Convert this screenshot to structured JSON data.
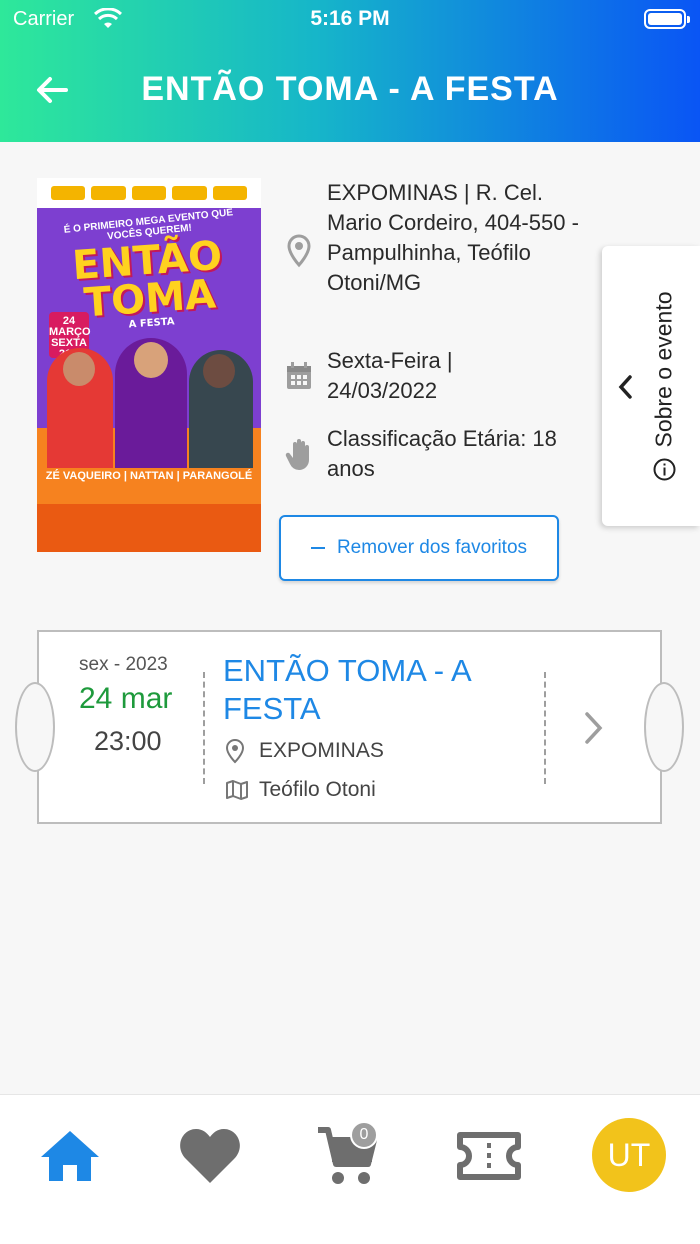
{
  "status_bar": {
    "carrier": "Carrier",
    "time": "5:16 PM"
  },
  "header": {
    "title": "ENTÃO TOMA - A FESTA",
    "back_icon": "arrow-left-icon"
  },
  "poster": {
    "tagline": "É O PRIMEIRO MEGA EVENTO QUE VOCÊS QUEREM!",
    "headline_1": "ENTÃO",
    "headline_2": "TOMA",
    "subheadline": "A FESTA",
    "date_badge": "24 MARÇO SEXTA 21H",
    "artists": "ZÉ VAQUEIRO | NATTAN | PARANGOLÉ"
  },
  "event": {
    "address": "EXPOMINAS | R. Cel. Mario Cordeiro, 404-550 - Pampulhinha, Teófilo Otoni/MG",
    "date": "Sexta-Feira | 24/03/2022",
    "rating": "Classificação Etária: 18 anos",
    "favorite_button": "Remover dos favoritos"
  },
  "side_tab": {
    "label": "Sobre o evento"
  },
  "ticket": {
    "weekday_year": "sex - 2023",
    "date": "24 mar",
    "time": "23:00",
    "title": "ENTÃO TOMA - A FESTA",
    "venue": "EXPOMINAS",
    "city": "Teófilo Otoni"
  },
  "bottom_nav": {
    "items": [
      "home-icon",
      "heart-icon",
      "cart-icon",
      "ticket-icon",
      "avatar"
    ],
    "cart_count": "0",
    "avatar_initials": "UT",
    "active": "home"
  },
  "colors": {
    "header_gradient": [
      "#2ee89a",
      "#0a55f5"
    ],
    "accent_blue": "#1e88e5",
    "date_green": "#1e9a3c",
    "avatar_yellow": "#f2c31b"
  }
}
